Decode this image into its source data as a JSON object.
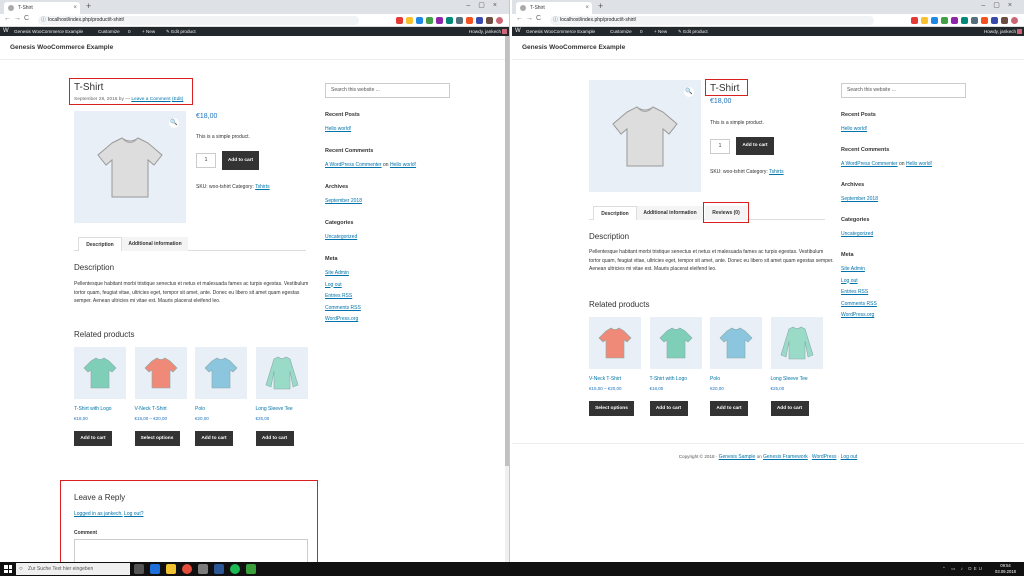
{
  "browser": {
    "tab_title": "T-Shirt",
    "tab_close": "×",
    "new_tab": "+",
    "window_controls": "–▢×",
    "nav": "←→C",
    "url": "localhost/index.php/product/t-shirt/",
    "lock": "ⓘ"
  },
  "wp_admin_bar": {
    "logo": "W",
    "site_name": "Genesis WooCommerce Example",
    "customize": "Customize",
    "comments": "0",
    "new": "+ New",
    "edit_product": "✎ Edit product",
    "howdy": "Howdy, jankech"
  },
  "site": {
    "title": "Genesis WooCommerce Example"
  },
  "product": {
    "title": "T-Shirt",
    "date": "September 28, 2016 by",
    "dash": "—",
    "leave_comment": "Leave a Comment",
    "edit": "(Edit)",
    "price": "€18,00",
    "short_description": "This is a simple product.",
    "quantity": "1",
    "add_to_cart": "Add to cart",
    "sku": "SKU: woo-tshirt Category:",
    "category": "Tshirts",
    "zoom_icon": "🔍"
  },
  "tabs": {
    "description": "Description",
    "additional_information": "Additional information",
    "reviews": "Reviews (0)"
  },
  "description": {
    "heading": "Description",
    "text": "Pellentesque habitant morbi tristique senectus et netus et malesuada fames ac turpis egestas. Vestibulum tortor quam, feugiat vitae, ultricies eget, tempor sit amet, ante. Donec eu libero sit amet quam egestas semper. Aenean ultricies mi vitae est. Mauris placerat eleifend leo."
  },
  "related": {
    "heading": "Related products",
    "left": [
      {
        "name": "T-Shirt with Logo",
        "price": "€18,00",
        "button": "Add to cart",
        "color": "#7fcfb8"
      },
      {
        "name": "V-Neck T-Shirt",
        "price": "€15,00 – €20,00",
        "button": "Select options",
        "color": "#f08a78"
      },
      {
        "name": "Polo",
        "price": "€20,00",
        "button": "Add to cart",
        "color": "#8cc6de"
      },
      {
        "name": "Long Sleeve Tee",
        "price": "€25,00",
        "button": "Add to cart",
        "color": "#9adbc8"
      }
    ],
    "right": [
      {
        "name": "V-Neck T-Shirt",
        "price": "€15,00 – €20,00",
        "button": "Select options",
        "color": "#f08a78"
      },
      {
        "name": "T-Shirt with Logo",
        "price": "€18,00",
        "button": "Add to cart",
        "color": "#7fcfb8"
      },
      {
        "name": "Polo",
        "price": "€20,00",
        "button": "Add to cart",
        "color": "#8cc6de"
      },
      {
        "name": "Long Sleeve Tee",
        "price": "€25,00",
        "button": "Add to cart",
        "color": "#9adbc8"
      }
    ]
  },
  "reply": {
    "heading": "Leave a Reply",
    "logged_in": "Logged in as jankech.",
    "logout": "Log out?",
    "comment_label": "Comment"
  },
  "sidebar": {
    "search_placeholder": "Search this website ...",
    "recent_posts": "Recent Posts",
    "hello_world": "Hello world!",
    "recent_comments": "Recent Comments",
    "commenter": "A WordPress Commenter",
    "on": "on",
    "archives": "Archives",
    "archive_month": "September 2018",
    "categories": "Categories",
    "uncategorized": "Uncategorized",
    "meta": "Meta",
    "meta_links": [
      "Site Admin",
      "Log out",
      "Entries RSS",
      "Comments RSS",
      "WordPress.org"
    ]
  },
  "footer": {
    "copyright": "Copyright © 2018 ·",
    "genesis_sample": "Genesis Sample",
    "on": "on",
    "genesis_framework": "Genesis Framework",
    "wordpress": "WordPress",
    "log_out": "Log out",
    "sep": "·"
  },
  "taskbar": {
    "search_placeholder": "Zur Suche Text hier eingeben",
    "tray": "⌃ ▭ ♪ DEU",
    "time": "09:54",
    "date": "03.09.2018"
  },
  "colors": {
    "red_outline": "#d9201f",
    "link": "#0073aa",
    "price": "#1e73be",
    "button": "#333333",
    "admin_bar": "#23282d"
  }
}
